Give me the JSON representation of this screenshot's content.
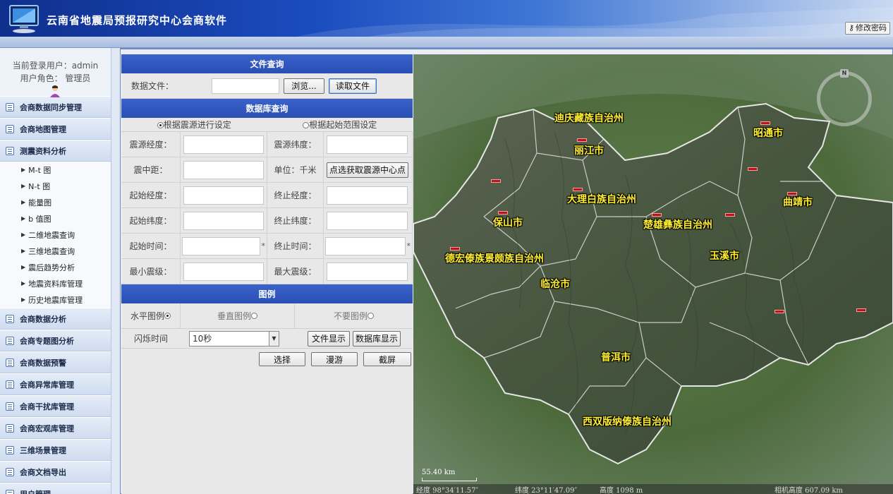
{
  "app": {
    "title": "云南省地震局预报研究中心会商软件",
    "change_password": "修改密码"
  },
  "user": {
    "login_label": "当前登录用户：admin",
    "role_label": "用户角色： 管理员"
  },
  "sidebar": {
    "items": [
      {
        "label": "会商数据同步管理"
      },
      {
        "label": "会商地图管理"
      },
      {
        "label": "测震资料分析"
      }
    ],
    "sub_items": [
      {
        "label": "M-t 图"
      },
      {
        "label": "N-t 图"
      },
      {
        "label": "能量图"
      },
      {
        "label": "b 值图"
      },
      {
        "label": "二维地震查询"
      },
      {
        "label": "三维地震查询"
      },
      {
        "label": "震后趋势分析"
      },
      {
        "label": "地震资料库管理"
      },
      {
        "label": "历史地震库管理"
      }
    ],
    "items_after": [
      {
        "label": "会商数据分析"
      },
      {
        "label": "会商专题图分析"
      },
      {
        "label": "会商数据预警"
      },
      {
        "label": "会商异常库管理"
      },
      {
        "label": "会商干扰库管理"
      },
      {
        "label": "会商宏观库管理"
      },
      {
        "label": "三维场景管理"
      },
      {
        "label": "会商文档导出"
      },
      {
        "label": "用户管理"
      }
    ]
  },
  "file_query": {
    "title": "文件查询",
    "data_file_label": "数据文件：",
    "browse_button": "浏览...",
    "read_button": "读取文件"
  },
  "db_query": {
    "title": "数据库查询",
    "radio_source": "根据震源进行设定",
    "radio_range": "根据起始范围设定",
    "source_lon": "震源经度：",
    "source_lat": "震源纬度：",
    "epi_distance": "震中距：",
    "unit": "单位：千米",
    "pick_center_button": "点选获取震源中心点",
    "start_lon": "起始经度：",
    "end_lon": "终止经度：",
    "start_lat": "起始纬度：",
    "end_lat": "终止纬度：",
    "start_time": "起始时间：",
    "end_time": "终止时间：",
    "min_mag": "最小震级：",
    "max_mag": "最大震级：",
    "required_mark": "*"
  },
  "legend": {
    "title": "图例",
    "horizontal": "水平图例",
    "vertical": "垂直图例",
    "none": "不要图例",
    "flash_label": "闪烁时间",
    "flash_value": "10秒",
    "file_display": "文件显示",
    "db_display": "数据库显示",
    "select_button": "选择",
    "roam_button": "漫游",
    "screenshot_button": "截屏"
  },
  "map": {
    "places": [
      {
        "name": "迪庆藏族自治州"
      },
      {
        "name": "丽江市"
      },
      {
        "name": "昭通市"
      },
      {
        "name": "大理白族自治州"
      },
      {
        "name": "曲靖市"
      },
      {
        "name": "保山市"
      },
      {
        "name": "楚雄彝族自治州"
      },
      {
        "name": "玉溪市"
      },
      {
        "name": "德宏傣族景颇族自治州"
      },
      {
        "name": "临沧市"
      },
      {
        "name": "普洱市"
      },
      {
        "name": "西双版纳傣族自治州"
      }
    ],
    "compass_n": "N",
    "scale": "55.40 km",
    "status": {
      "lon": "经度 98°34′11.57″",
      "lat": "纬度 23°11′47.09″",
      "elev": "高度 1098 m",
      "eye": "相机高度 607.09 km"
    },
    "marker_color": "#b3161c",
    "label_color": "#ffef2e"
  }
}
